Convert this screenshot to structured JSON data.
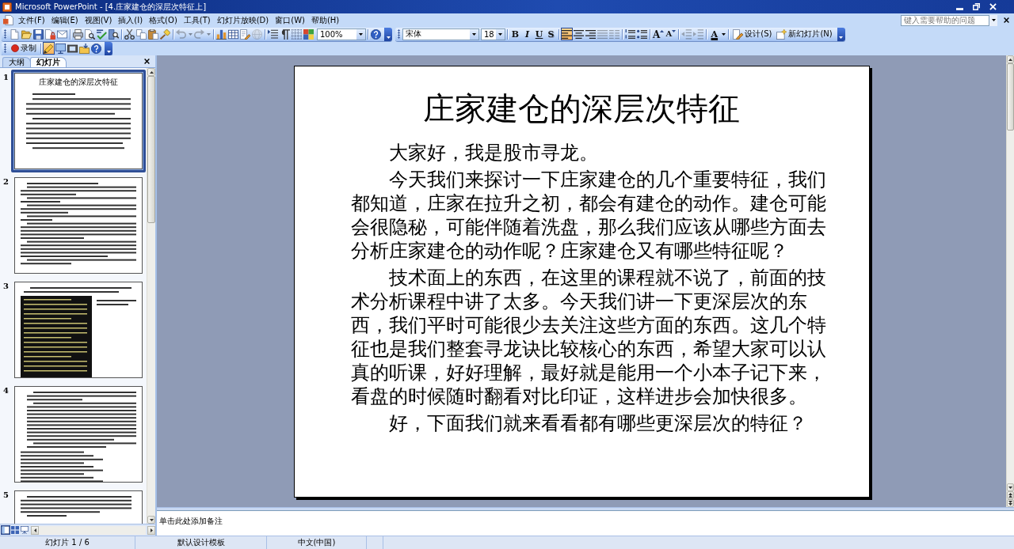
{
  "window": {
    "title": "Microsoft PowerPoint - [4.庄家建仓的深层次特征上]"
  },
  "menu": [
    "文件(F)",
    "编辑(E)",
    "视图(V)",
    "插入(I)",
    "格式(O)",
    "工具(T)",
    "幻灯片放映(D)",
    "窗口(W)",
    "帮助(H)"
  ],
  "help_box": {
    "placeholder": "键入需要帮助的问题"
  },
  "standard_toolbar": {
    "buttons": [
      {
        "disabled": false
      },
      {
        "disabled": false
      },
      {
        "disabled": false
      },
      {
        "disabled": false
      },
      {
        "disabled": false
      },
      {
        "disabled": false
      },
      {
        "disabled": false
      },
      {
        "disabled": false
      },
      {
        "disabled": false
      },
      {
        "disabled": false
      },
      {
        "disabled": false
      },
      {
        "disabled": false
      },
      {
        "disabled": false
      },
      {
        "disabled": true
      },
      {
        "disabled": true
      },
      {
        "disabled": true
      },
      {
        "disabled": true
      },
      {
        "disabled": false
      },
      {
        "disabled": false
      },
      {
        "disabled": false
      },
      {
        "disabled": true
      },
      {
        "disabled": false
      },
      {
        "disabled": false
      },
      {
        "disabled": false
      },
      {
        "disabled": false
      }
    ],
    "zoom": "100%"
  },
  "formatting_toolbar": {
    "font": "宋体",
    "size": "18",
    "style_buttons": [
      {
        "label": "B"
      },
      {
        "label": "I"
      },
      {
        "label": "U"
      },
      {
        "label": "S"
      }
    ],
    "align_buttons": [
      {
        "selected": true
      },
      {
        "selected": false
      },
      {
        "selected": false
      }
    ],
    "paragraph_buttons": [
      {
        "disabled": true
      },
      {
        "disabled": true
      },
      {
        "disabled": false
      },
      {
        "disabled": false
      }
    ],
    "font_size_buttons": [
      {
        "label": "A"
      },
      {
        "label": "A"
      }
    ],
    "indent_buttons": [
      {
        "disabled": true
      },
      {
        "disabled": true
      }
    ],
    "font_color_button": "A",
    "design_button": "设计(S)",
    "new_slide_button": "新幻灯片(N)"
  },
  "recording_toolbar": {
    "record_button": "录制",
    "buttons": [
      {
        "selected": true
      },
      {
        "selected": false
      },
      {
        "selected": false
      },
      {
        "selected": false
      },
      {
        "selected": false
      }
    ]
  },
  "pane_tabs": [
    {
      "label": "大纲",
      "selected": false
    },
    {
      "label": "幻灯片",
      "selected": true
    }
  ],
  "thumbnails": [
    {
      "number": "1",
      "selected": true,
      "kind": "title_text",
      "title": "庄家建仓的深层次特征"
    },
    {
      "number": "2",
      "selected": false,
      "kind": "text"
    },
    {
      "number": "3",
      "selected": false,
      "kind": "image_text"
    },
    {
      "number": "4",
      "selected": false,
      "kind": "list"
    },
    {
      "number": "5",
      "selected": false,
      "kind": "text_table"
    }
  ],
  "view_buttons": [
    {
      "selected": true
    },
    {
      "selected": false
    },
    {
      "selected": false
    }
  ],
  "slide": {
    "title": "庄家建仓的深层次特征",
    "paragraphs": [
      "大家好，我是股市寻龙。",
      "今天我们来探讨一下庄家建仓的几个重要特征，我们都知道，庄家在拉升之初，都会有建仓的动作。建仓可能会很隐秘，可能伴随着洗盘，那么我们应该从哪些方面去分析庄家建仓的动作呢？庄家建仓又有哪些特征呢？",
      "技术面上的东西，在这里的课程就不说了，前面的技术分析课程中讲了太多。今天我们讲一下更深层次的东西，我们平时可能很少去关注这些方面的东西。这几个特征也是我们整套寻龙诀比较核心的东西，希望大家可以认真的听课，好好理解，最好就是能用一个小本子记下来，看盘的时候随时翻看对比印证，这样进步会加快很多。",
      "好，下面我们就来看看都有哪些更深层次的特征？"
    ]
  },
  "notes": {
    "placeholder": "单击此处添加备注"
  },
  "status_bar": [
    "幻灯片 1 / 6",
    "默认设计模板",
    "中文(中国)"
  ]
}
